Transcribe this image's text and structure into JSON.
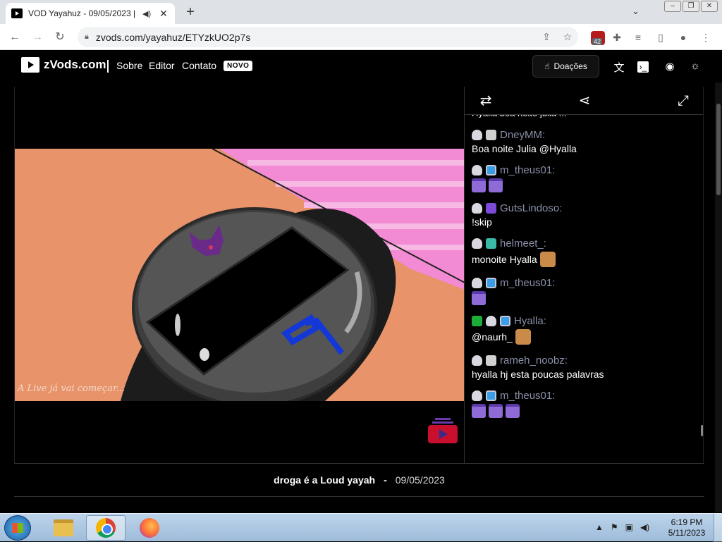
{
  "browser": {
    "tab_title": "VOD Yayahuz - 09/05/2023 |",
    "url": "zvods.com/yayahuz/ETYzkUO2p7s",
    "extension_badge_count": "42"
  },
  "site": {
    "logo_text": "zVods.com",
    "nav": [
      "Sobre",
      "Editor",
      "Contato"
    ],
    "new_badge": "NOVO",
    "donate_label": "Doações"
  },
  "video": {
    "overlay_text": "A Live já vai começar..."
  },
  "chat": {
    "cut_off_line": "Hyalla boa noite julia ...",
    "messages": [
      {
        "user": "DneyMM",
        "badges": [
          "sheep",
          "mute"
        ],
        "text": "Boa noite Julia @Hyalla",
        "emotes": 0
      },
      {
        "user": "m_theus01",
        "badges": [
          "sheep",
          "sub"
        ],
        "text": "",
        "emotes": 2
      },
      {
        "user": "GutsLindoso",
        "badges": [
          "sheep",
          "purple"
        ],
        "text": "!skip",
        "emotes": 0
      },
      {
        "user": "helmeet_",
        "badges": [
          "sheep",
          "gift"
        ],
        "text": "monoite Hyalla",
        "emotes": 0,
        "dog": true
      },
      {
        "user": "m_theus01",
        "badges": [
          "sheep",
          "sub"
        ],
        "text": "",
        "emotes": 1
      },
      {
        "user": "Hyalla",
        "badges": [
          "mod",
          "sheep",
          "sub"
        ],
        "text": "@naurh_",
        "emotes": 0,
        "dog": true
      },
      {
        "user": "rameh_noobz",
        "badges": [
          "sheep",
          "mute"
        ],
        "text": "hyalla hj esta poucas palavras",
        "emotes": 0
      },
      {
        "user": "m_theus01",
        "badges": [
          "sheep",
          "sub"
        ],
        "text": "",
        "emotes": 3
      }
    ]
  },
  "vod": {
    "title": "droga é a Loud yayah",
    "separator": "-",
    "date": "09/05/2023"
  },
  "taskbar": {
    "time": "6:19 PM",
    "date": "5/11/2023"
  }
}
